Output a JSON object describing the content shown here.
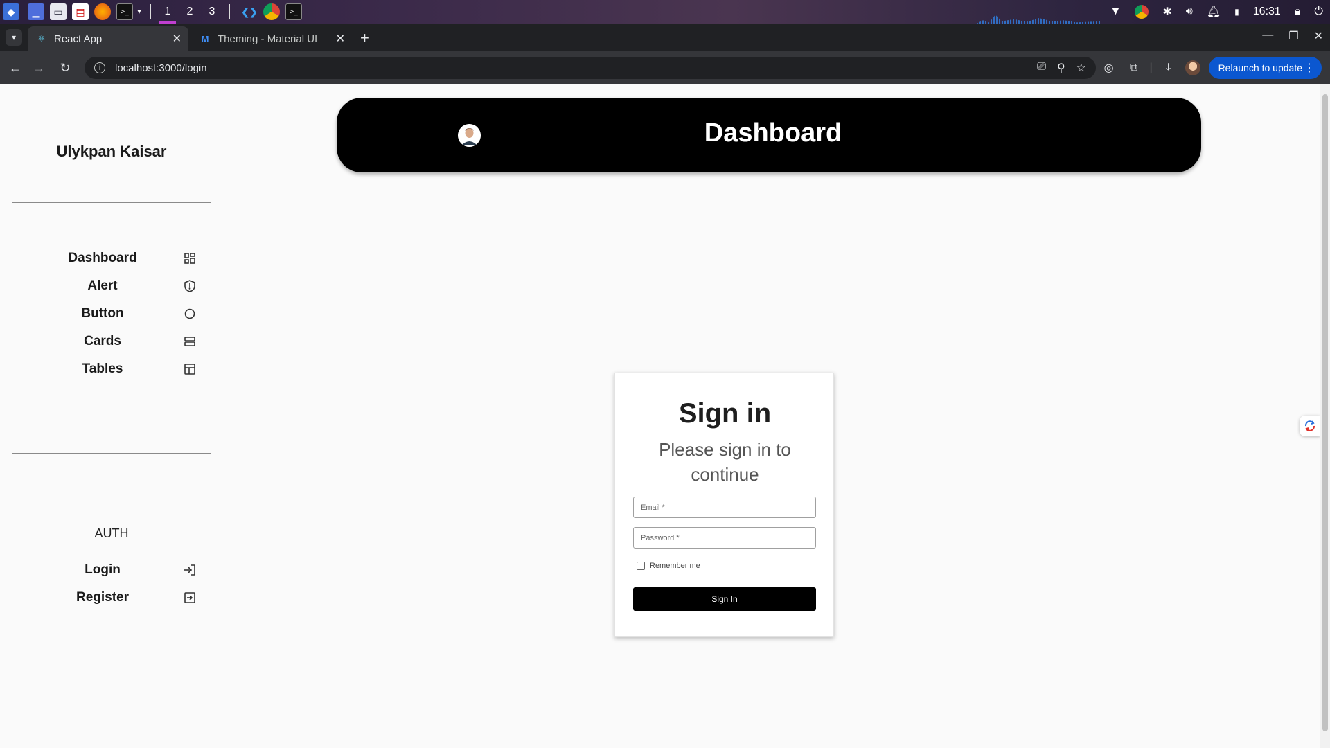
{
  "taskbar": {
    "workspaces": [
      "1",
      "2",
      "3"
    ],
    "time": "16:31"
  },
  "browser": {
    "tabs": [
      {
        "title": "React App",
        "favicon": "react-icon",
        "active": true
      },
      {
        "title": "Theming - Material UI",
        "favicon": "mui-icon",
        "active": false
      }
    ],
    "url": "localhost:3000/login",
    "relaunch_label": "Relaunch to update"
  },
  "sidebar": {
    "user_name": "Ulykpan Kaisar",
    "nav_items": [
      {
        "label": "Dashboard",
        "icon": "grid-icon"
      },
      {
        "label": "Alert",
        "icon": "shield-icon"
      },
      {
        "label": "Button",
        "icon": "circle-icon"
      },
      {
        "label": "Cards",
        "icon": "stack-icon"
      },
      {
        "label": "Tables",
        "icon": "table-icon"
      }
    ],
    "auth_heading": "AUTH",
    "auth_items": [
      {
        "label": "Login",
        "icon": "login-icon"
      },
      {
        "label": "Register",
        "icon": "register-icon"
      }
    ]
  },
  "header": {
    "title": "Dashboard"
  },
  "login": {
    "title": "Sign in",
    "subtitle": "Please sign in to continue",
    "email_placeholder": "Email *",
    "password_placeholder": "Password *",
    "remember_label": "Remember me",
    "submit_label": "Sign In"
  },
  "colors": {
    "header_bg": "#000000",
    "primary_button": "#000000",
    "relaunch_bg": "#0b57d0"
  }
}
